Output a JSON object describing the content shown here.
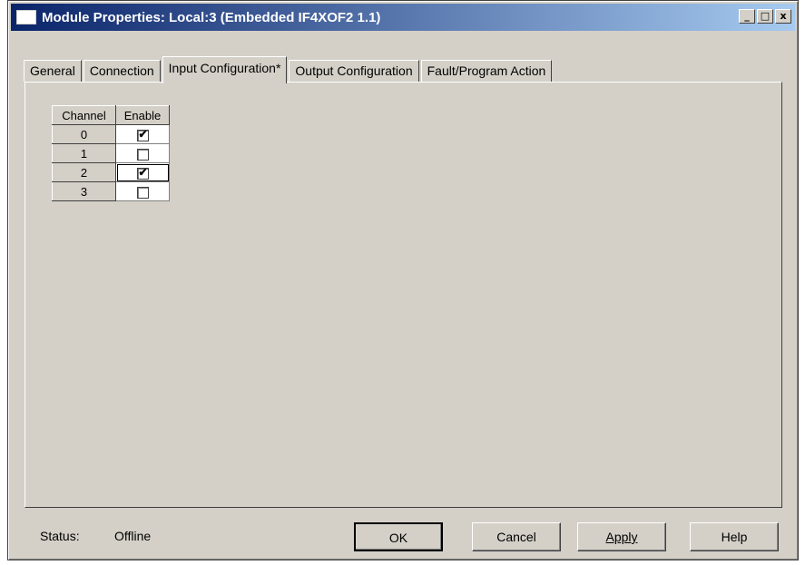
{
  "window": {
    "title": "Module Properties: Local:3 (Embedded IF4XOF2 1.1)"
  },
  "title_buttons": {
    "minimize": "_",
    "maximize": "□",
    "close": "x"
  },
  "tabs": [
    {
      "label": "General"
    },
    {
      "label": "Connection"
    },
    {
      "label": "Input Configuration*",
      "active": true
    },
    {
      "label": "Output Configuration"
    },
    {
      "label": "Fault/Program Action"
    }
  ],
  "grid": {
    "headers": {
      "channel": "Channel",
      "enable": "Enable"
    },
    "rows": [
      {
        "channel": "0",
        "enabled": true,
        "mark": "✔"
      },
      {
        "channel": "1",
        "enabled": false,
        "mark": ""
      },
      {
        "channel": "2",
        "enabled": true,
        "mark": "✔",
        "focused": true
      },
      {
        "channel": "3",
        "enabled": false,
        "mark": ""
      }
    ]
  },
  "status": {
    "label": "Status:",
    "value": "Offline"
  },
  "buttons": {
    "ok": "OK",
    "cancel": "Cancel",
    "apply": "Apply",
    "help": "Help"
  }
}
